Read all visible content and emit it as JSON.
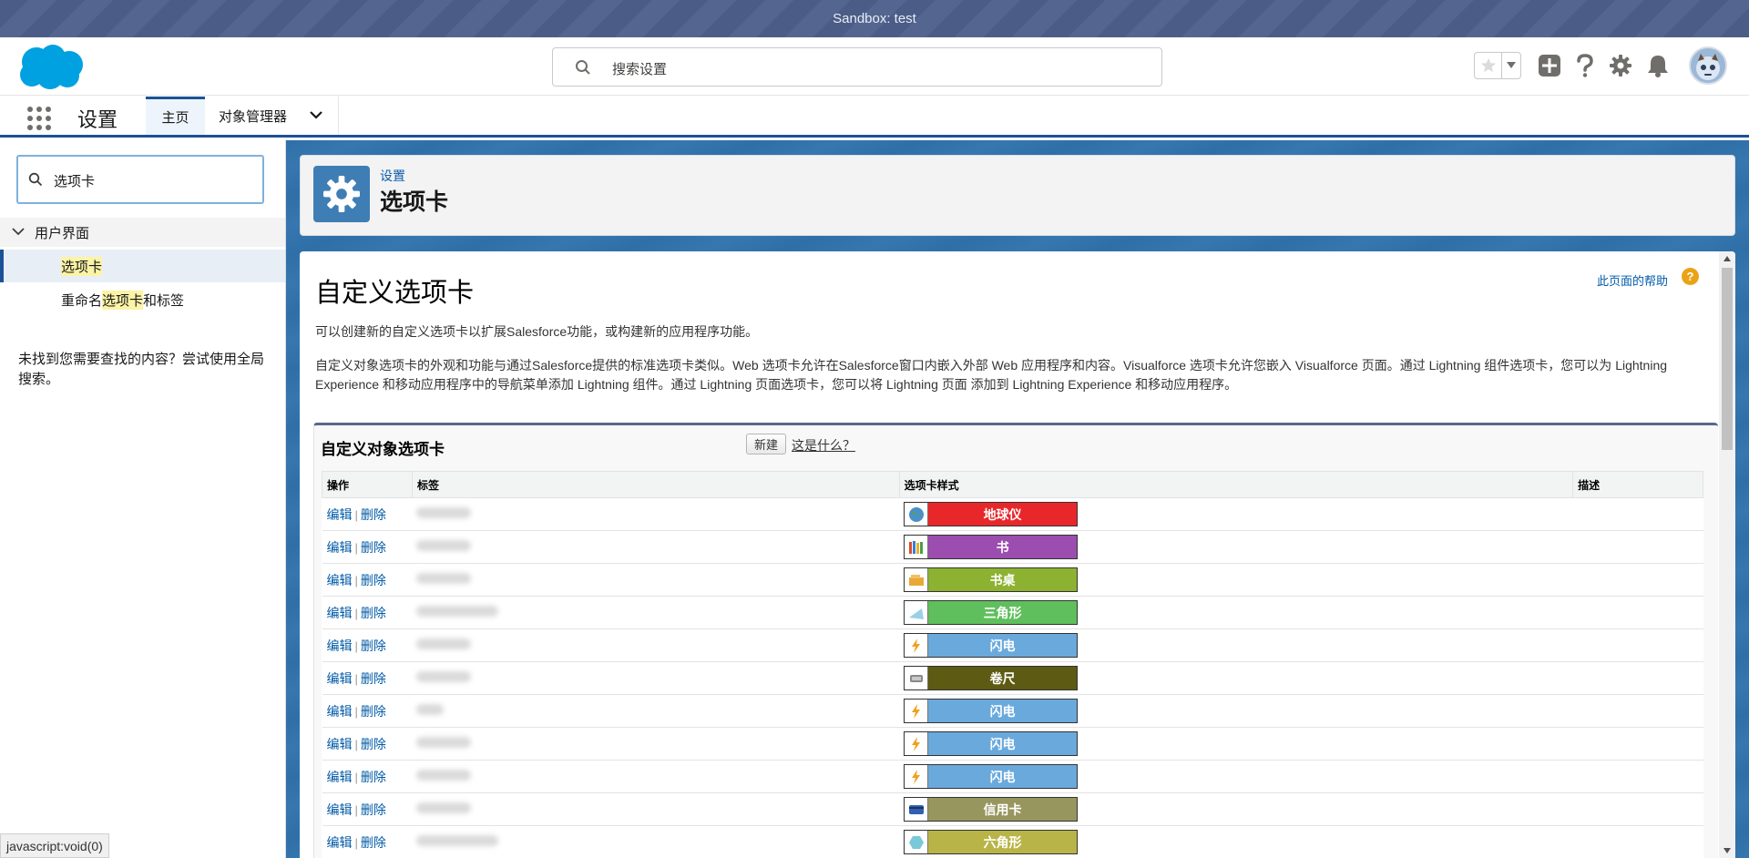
{
  "sandbox_banner": "Sandbox: test",
  "global_search": {
    "placeholder": "搜索设置"
  },
  "context_bar": {
    "app_name": "设置",
    "tabs": [
      {
        "label": "主页"
      },
      {
        "label": "对象管理器"
      }
    ]
  },
  "sidebar": {
    "quickfind_value": "选项卡",
    "group_label": "用户界面",
    "items": [
      {
        "label": "选项卡"
      },
      {
        "pre": "重命名",
        "hl": "选项卡",
        "post": "和标签"
      }
    ],
    "note": "未找到您需要查找的内容？尝试使用全局搜索。"
  },
  "page_header": {
    "breadcrumb": "设置",
    "title": "选项卡"
  },
  "content": {
    "help_link": "此页面的帮助",
    "help_icon_text": "?",
    "title": "自定义选项卡",
    "desc1": "可以创建新的自定义选项卡以扩展Salesforce功能，或构建新的应用程序功能。",
    "desc2": "自定义对象选项卡的外观和功能与通过Salesforce提供的标准选项卡类似。Web 选项卡允许在Salesforce窗口内嵌入外部 Web 应用程序和内容。Visualforce 选项卡允许您嵌入 Visualforce 页面。通过 Lightning 组件选项卡，您可以为 Lightning Experience 和移动应用程序中的导航菜单添加 Lightning 组件。通过 Lightning 页面选项卡，您可以将 Lightning 页面 添加到 Lightning Experience 和移动应用程序。"
  },
  "related_list": {
    "title": "自定义对象选项卡",
    "new_button": "新建",
    "what_link": "这是什么？",
    "columns": {
      "action": "操作",
      "label": "标签",
      "style": "选项卡样式",
      "description": "描述"
    },
    "action_edit": "编辑",
    "action_delete": "删除",
    "rows": [
      {
        "style_name": "地球仪",
        "color": "#e8272b",
        "icon": "globe-icon"
      },
      {
        "style_name": "书",
        "color": "#9b4eaf",
        "icon": "books-icon"
      },
      {
        "style_name": "书桌",
        "color": "#8db130",
        "icon": "desk-icon"
      },
      {
        "style_name": "三角形",
        "color": "#5fbf5c",
        "icon": "triangle-icon"
      },
      {
        "style_name": "闪电",
        "color": "#6aa9dc",
        "icon": "lightning-icon"
      },
      {
        "style_name": "卷尺",
        "color": "#5d5b13",
        "icon": "tape-measure-icon"
      },
      {
        "style_name": "闪电",
        "color": "#6aa9dc",
        "icon": "lightning-icon"
      },
      {
        "style_name": "闪电",
        "color": "#6aa9dc",
        "icon": "lightning-icon"
      },
      {
        "style_name": "闪电",
        "color": "#6aa9dc",
        "icon": "lightning-icon"
      },
      {
        "style_name": "信用卡",
        "color": "#98965f",
        "icon": "credit-card-icon"
      },
      {
        "style_name": "六角形",
        "color": "#b9b447",
        "icon": "hexagon-icon"
      }
    ]
  },
  "status_bar": "javascript:void(0)"
}
